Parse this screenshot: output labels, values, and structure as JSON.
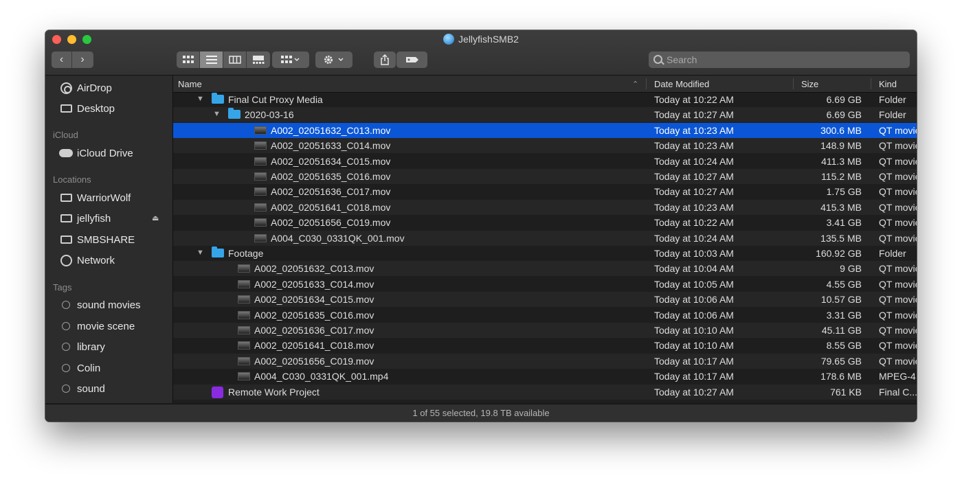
{
  "window": {
    "title": "JellyfishSMB2"
  },
  "toolbar": {
    "back_glyph": "‹",
    "forward_glyph": "›",
    "search_placeholder": "Search"
  },
  "sidebar": {
    "favorites": [
      {
        "label": "AirDrop",
        "icon": "airdrop-icon"
      },
      {
        "label": "Desktop",
        "icon": "desktop-icon"
      }
    ],
    "icloud_header": "iCloud",
    "icloud": [
      {
        "label": "iCloud Drive",
        "icon": "cloud-icon"
      }
    ],
    "locations_header": "Locations",
    "locations": [
      {
        "label": "WarriorWolf",
        "icon": "computer-icon"
      },
      {
        "label": "jellyfish",
        "icon": "display-icon",
        "eject": true
      },
      {
        "label": "SMBSHARE",
        "icon": "display-icon"
      },
      {
        "label": "Network",
        "icon": "globe-icon"
      }
    ],
    "tags_header": "Tags",
    "tags": [
      {
        "label": "sound movies"
      },
      {
        "label": "movie scene"
      },
      {
        "label": "library"
      },
      {
        "label": "Colin"
      },
      {
        "label": "sound"
      }
    ]
  },
  "columns": {
    "name": "Name",
    "date": "Date Modified",
    "size": "Size",
    "kind": "Kind"
  },
  "rows": [
    {
      "name": "Final Cut Proxy Media",
      "date": "Today at 10:22 AM",
      "size": "6.69 GB",
      "kind": "Folder",
      "type": "folder",
      "level": 0,
      "expanded": true
    },
    {
      "name": "2020-03-16",
      "date": "Today at 10:27 AM",
      "size": "6.69 GB",
      "kind": "Folder",
      "type": "folder",
      "level": 1,
      "expanded": true
    },
    {
      "name": "A002_02051632_C013.mov",
      "date": "Today at 10:23 AM",
      "size": "300.6 MB",
      "kind": "QT movie",
      "type": "movie",
      "level": 2,
      "selected": true
    },
    {
      "name": "A002_02051633_C014.mov",
      "date": "Today at 10:23 AM",
      "size": "148.9 MB",
      "kind": "QT movie",
      "type": "movie",
      "level": 2
    },
    {
      "name": "A002_02051634_C015.mov",
      "date": "Today at 10:24 AM",
      "size": "411.3 MB",
      "kind": "QT movie",
      "type": "movie",
      "level": 2
    },
    {
      "name": "A002_02051635_C016.mov",
      "date": "Today at 10:27 AM",
      "size": "115.2 MB",
      "kind": "QT movie",
      "type": "movie",
      "level": 2
    },
    {
      "name": "A002_02051636_C017.mov",
      "date": "Today at 10:27 AM",
      "size": "1.75 GB",
      "kind": "QT movie",
      "type": "movie",
      "level": 2
    },
    {
      "name": "A002_02051641_C018.mov",
      "date": "Today at 10:23 AM",
      "size": "415.3 MB",
      "kind": "QT movie",
      "type": "movie",
      "level": 2
    },
    {
      "name": "A002_02051656_C019.mov",
      "date": "Today at 10:22 AM",
      "size": "3.41 GB",
      "kind": "QT movie",
      "type": "movie",
      "level": 2
    },
    {
      "name": "A004_C030_0331QK_001.mov",
      "date": "Today at 10:24 AM",
      "size": "135.5 MB",
      "kind": "QT movie",
      "type": "movie",
      "level": 2
    },
    {
      "name": "Footage",
      "date": "Today at 10:03 AM",
      "size": "160.92 GB",
      "kind": "Folder",
      "type": "folder",
      "level": 0,
      "expanded": true
    },
    {
      "name": "A002_02051632_C013.mov",
      "date": "Today at 10:04 AM",
      "size": "9 GB",
      "kind": "QT movie",
      "type": "movie",
      "level": 1
    },
    {
      "name": "A002_02051633_C014.mov",
      "date": "Today at 10:05 AM",
      "size": "4.55 GB",
      "kind": "QT movie",
      "type": "movie",
      "level": 1
    },
    {
      "name": "A002_02051634_C015.mov",
      "date": "Today at 10:06 AM",
      "size": "10.57 GB",
      "kind": "QT movie",
      "type": "movie",
      "level": 1
    },
    {
      "name": "A002_02051635_C016.mov",
      "date": "Today at 10:06 AM",
      "size": "3.31 GB",
      "kind": "QT movie",
      "type": "movie",
      "level": 1
    },
    {
      "name": "A002_02051636_C017.mov",
      "date": "Today at 10:10 AM",
      "size": "45.11 GB",
      "kind": "QT movie",
      "type": "movie",
      "level": 1
    },
    {
      "name": "A002_02051641_C018.mov",
      "date": "Today at 10:10 AM",
      "size": "8.55 GB",
      "kind": "QT movie",
      "type": "movie",
      "level": 1
    },
    {
      "name": "A002_02051656_C019.mov",
      "date": "Today at 10:17 AM",
      "size": "79.65 GB",
      "kind": "QT movie",
      "type": "movie",
      "level": 1
    },
    {
      "name": "A004_C030_0331QK_001.mp4",
      "date": "Today at 10:17 AM",
      "size": "178.6 MB",
      "kind": "MPEG-4",
      "type": "movie",
      "level": 1
    },
    {
      "name": "Remote Work Project",
      "date": "Today at 10:27 AM",
      "size": "761 KB",
      "kind": "Final C...",
      "type": "project",
      "level": 0
    }
  ],
  "status": {
    "text": "1 of 55 selected, 19.8 TB available"
  }
}
